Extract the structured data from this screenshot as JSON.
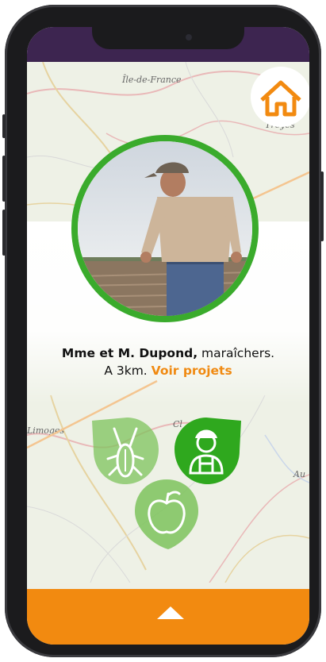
{
  "map": {
    "labels": [
      "Île-de-France",
      "Troyes",
      "Limoges",
      "Cl",
      "Au"
    ]
  },
  "header": {
    "home_icon": "home-icon"
  },
  "producer": {
    "name": "Mme et M. Dupond,",
    "role": " maraîchers.",
    "distance": "A 3km.",
    "link_label": "Voir projets",
    "photo_icon": "farmer-photo"
  },
  "categories": [
    {
      "name": "cricket-icon",
      "selected": false
    },
    {
      "name": "farmer-icon",
      "selected": true
    },
    {
      "name": "apple-icon",
      "selected": false
    }
  ],
  "footer": {
    "arrow_icon": "chevron-up-icon"
  },
  "colors": {
    "accent": "#f28a10",
    "green": "#3aab2c",
    "green_light": "#7dc35c",
    "topbar": "#3d2550"
  }
}
